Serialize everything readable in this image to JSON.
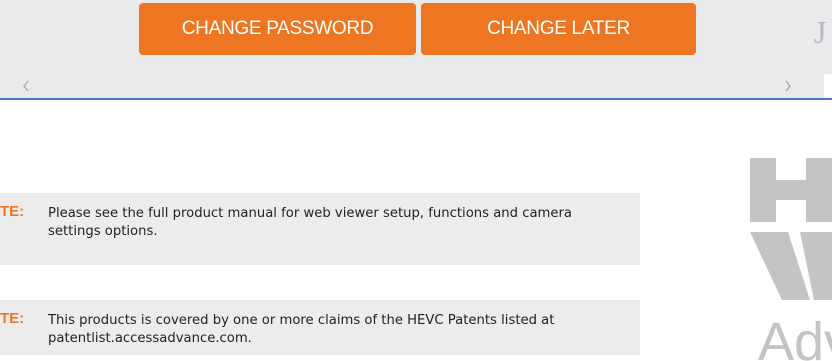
{
  "dialog": {
    "change_password_label": "CHANGE PASSWORD",
    "change_later_label": "CHANGE LATER",
    "partial_glyph": "J"
  },
  "scrollbar": {
    "left_icon": "chevron-left-icon",
    "right_icon": "chevron-right-icon"
  },
  "notes": [
    {
      "label": "TE:",
      "text": "Please see the full product manual for web viewer setup, functions and camera settings options."
    },
    {
      "label": "TE:",
      "text": "This products is covered by one or more claims of the HEVC Patents listed at patentlist.accessadvance.com."
    }
  ],
  "logo": {
    "text": "Advan"
  },
  "colors": {
    "accent": "#ee7622",
    "divider_blue": "#4a78c2",
    "panel_gray": "#e9eaeb",
    "note_gray": "#ececed",
    "logo_gray": "#c2c4c6"
  }
}
